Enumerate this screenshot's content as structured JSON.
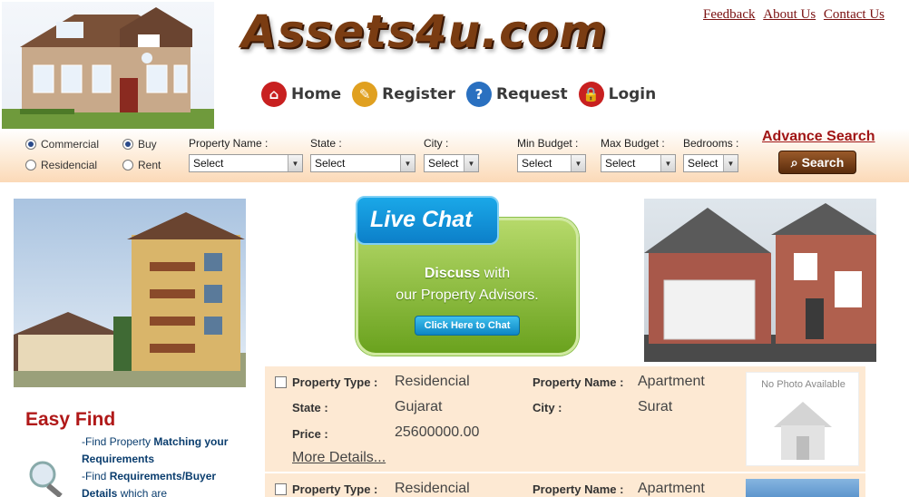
{
  "header": {
    "logo_text": "Assets4u.com",
    "top_links": [
      "Feedback",
      "About Us",
      "Contact Us"
    ],
    "nav": [
      {
        "label": "Home",
        "icon": "home-icon",
        "color": "#c82020"
      },
      {
        "label": "Register",
        "icon": "register-icon",
        "color": "#e0a020"
      },
      {
        "label": "Request",
        "icon": "request-icon",
        "color": "#2a70c0"
      },
      {
        "label": "Login",
        "icon": "lock-icon",
        "color": "#c82020"
      }
    ]
  },
  "search": {
    "radios": {
      "commercial": "Commercial",
      "residencial": "Residencial",
      "buy": "Buy",
      "rent": "Rent"
    },
    "fields": {
      "property_name": {
        "label": "Property Name :",
        "value": "Select"
      },
      "state": {
        "label": "State :",
        "value": "Select"
      },
      "city": {
        "label": "City :",
        "value": "Select"
      },
      "min_budget": {
        "label": "Min Budget :",
        "value": "Select"
      },
      "max_budget": {
        "label": "Max Budget :",
        "value": "Select"
      },
      "bedrooms": {
        "label": "Bedrooms :",
        "value": "Select"
      }
    },
    "advance_link": "Advance Search",
    "search_button": "Search"
  },
  "promo": {
    "live_chat_title": "Live Chat",
    "discuss_bold": "Discuss",
    "discuss_rest": " with",
    "line2": "our Property Advisors.",
    "chat_button": "Click Here to Chat"
  },
  "easy_find": {
    "title": "Easy Find",
    "item1_pre": "Find Property ",
    "item1_bold": "Matching your Requirements",
    "item2_pre": "Find ",
    "item2_bold": "Requirements/Buyer Details",
    "item2_post": " which are"
  },
  "listing_labels": {
    "property_type": "Property Type :",
    "property_name": "Property Name :",
    "state": "State :",
    "city": "City :",
    "price": "Price :",
    "more": "More Details...",
    "no_photo": "No Photo Available"
  },
  "listings": [
    {
      "property_type": "Residencial",
      "property_name": "Apartment",
      "state": "Gujarat",
      "city": "Surat",
      "price": "25600000.00"
    },
    {
      "property_type": "Residencial",
      "property_name": "Apartment"
    }
  ],
  "colors": {
    "accent": "#a01515",
    "bar": "#fde9d3",
    "chat_green": "#6aa21e",
    "chat_blue": "#0c7fc9"
  }
}
